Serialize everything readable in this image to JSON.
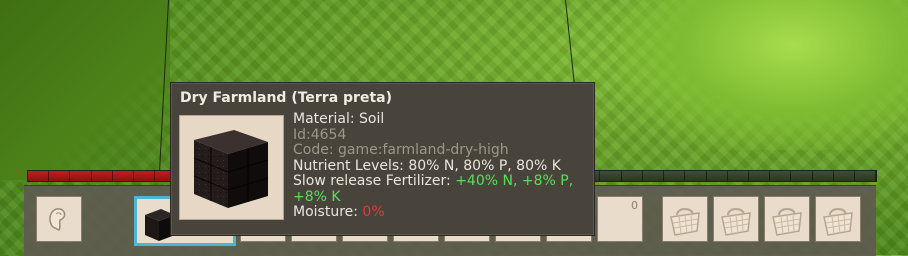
{
  "tooltip": {
    "title": "Dry Farmland (Terra preta)",
    "material_label": "Material: ",
    "material_value": "Soil",
    "id_text": "Id:4654",
    "code_text": "Code: game:farmland-dry-high",
    "nutrients_text": "Nutrient Levels: 80% N, 80% P, 80% K",
    "fertilizer_label": "Slow release Fertilizer: ",
    "fertilizer_value_1": "+40% N, +8% P,",
    "fertilizer_value_2": "+8% K",
    "moisture_label": "Moisture: ",
    "moisture_value": "0%"
  },
  "hotbar": {
    "count_label": "0",
    "slots": [
      {
        "item": "hide-icon"
      },
      {
        "item": "farmland-block-icon",
        "selected": true
      },
      {
        "item": "empty"
      },
      {
        "item": "empty"
      },
      {
        "item": "empty"
      },
      {
        "item": "empty"
      },
      {
        "item": "empty"
      },
      {
        "item": "empty"
      },
      {
        "item": "empty"
      },
      {
        "item": "basket-icon"
      },
      {
        "item": "basket-icon"
      },
      {
        "item": "basket-icon"
      },
      {
        "item": "basket-icon"
      }
    ]
  },
  "health": {
    "filled_fraction": 0.5
  },
  "colors": {
    "selected_slot": "#4fb3d6",
    "positive": "#56e05a",
    "negative": "#e23a3a",
    "health": "#c41d1d"
  }
}
